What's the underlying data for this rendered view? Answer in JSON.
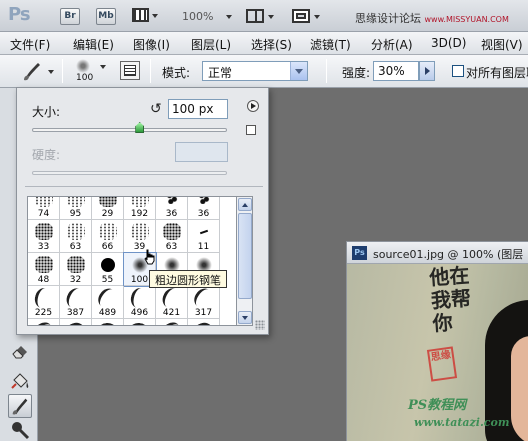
{
  "app": {
    "logo": "Ps",
    "bridge_button": "Br",
    "minibridge_button": "Mb",
    "zoom_level": "100%",
    "site_name": "思缘设计论坛",
    "site_url": "www.MISSYUAN.COM"
  },
  "menu": {
    "items": [
      "文件(F)",
      "编辑(E)",
      "图像(I)",
      "图层(L)",
      "选择(S)",
      "滤镜(T)",
      "分析(A)",
      "3D(D)",
      "视图(V)"
    ]
  },
  "options": {
    "brush_size": "100",
    "mode_label": "模式:",
    "mode_value": "正常",
    "opacity_label": "强度:",
    "opacity_value": "30%",
    "sample_all_label": "对所有图层取"
  },
  "brush_popup": {
    "size_label": "大小:",
    "size_value": "100 px",
    "size_slider_fraction": 0.55,
    "hardness_label": "硬度:",
    "tooltip": "粗边圆形钢笔",
    "presets": [
      "74",
      "95",
      "29",
      "192",
      "36",
      "36",
      "33",
      "63",
      "66",
      "39",
      "63",
      "11",
      "48",
      "32",
      "55",
      "100",
      "75",
      "",
      "225",
      "387",
      "489",
      "496",
      "421",
      "317",
      "",
      "",
      "",
      "",
      "",
      ""
    ]
  },
  "document": {
    "icon": "Ps",
    "title": "source01.jpg @ 100% (图层",
    "calligraphy": "他在我帮你",
    "seal": "思缘",
    "watermark_line1": "PS教程网",
    "watermark_line2": "www.tatazi.com"
  },
  "colors": {
    "accent": "#2d9a3b",
    "workspace": "#6e6e6e",
    "seal_red": "#cf3a34",
    "watermark_green": "#3f8f57"
  }
}
